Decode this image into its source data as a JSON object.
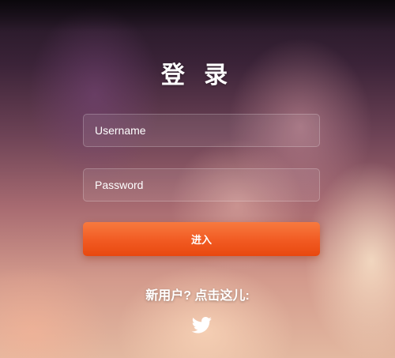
{
  "login": {
    "title": "登 录",
    "username_placeholder": "Username",
    "password_placeholder": "Password",
    "submit_label": "进入",
    "register_text": "新用户? 点击这儿:",
    "social_icon": "twitter-bird-icon"
  },
  "colors": {
    "accent": "#f15a22",
    "text": "#ffffff"
  }
}
